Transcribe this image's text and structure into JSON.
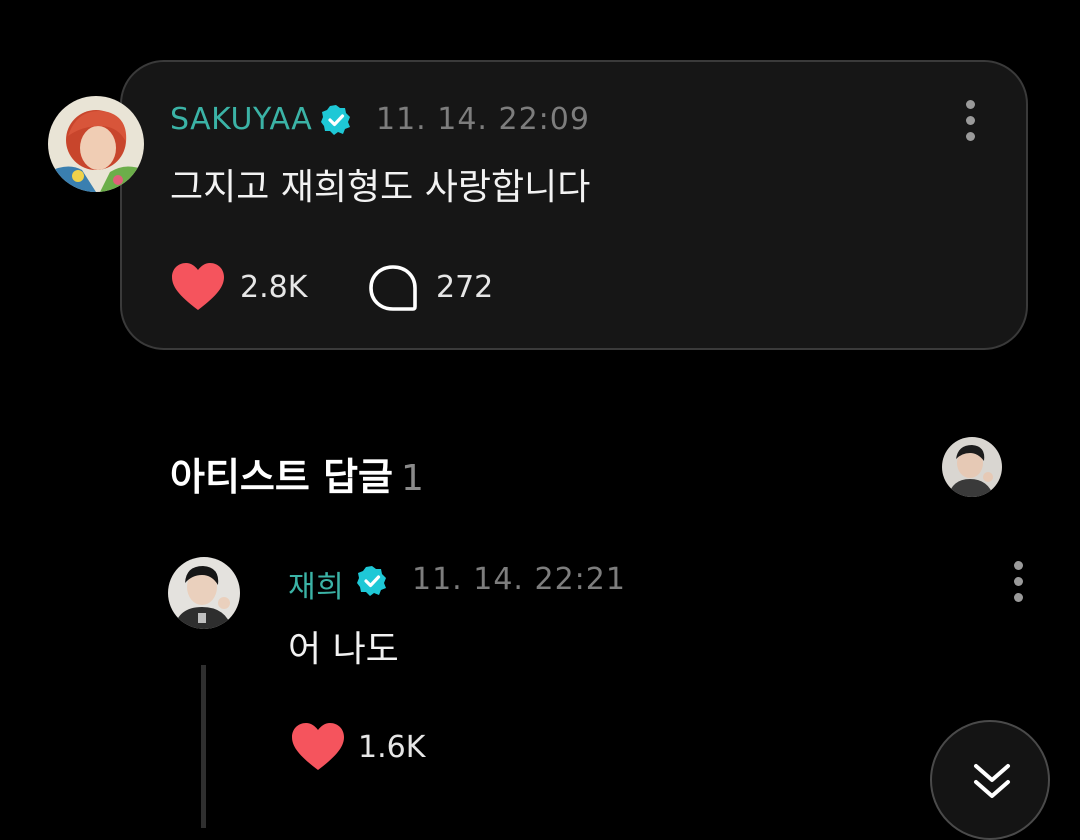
{
  "post": {
    "username": "SAKUYAA",
    "timestamp": "11. 14. 22:09",
    "text": "그지고 재희형도 사랑합니다",
    "like_count": "2.8K",
    "comment_count": "272",
    "verified_icon": "verified-badge-icon",
    "like_icon": "heart-icon",
    "comment_icon": "comment-bubble-icon",
    "more_icon": "more-vertical-icon"
  },
  "artist_replies": {
    "title": "아티스트 답글",
    "count": "1"
  },
  "reply": {
    "username": "재희",
    "timestamp": "11. 14. 22:21",
    "text": "어 나도",
    "like_count": "1.6K",
    "verified_icon": "verified-badge-icon",
    "like_icon": "heart-icon",
    "more_icon": "more-vertical-icon"
  },
  "scroll_button": {
    "icon": "double-chevron-down-icon"
  },
  "colors": {
    "background": "#000000",
    "card_background": "#161616",
    "card_border": "#3a3a3a",
    "accent_teal": "#3bb3a6",
    "verified_cyan": "#1ec8d6",
    "heart_red": "#f5545d",
    "timestamp_gray": "#7d7d7d"
  }
}
